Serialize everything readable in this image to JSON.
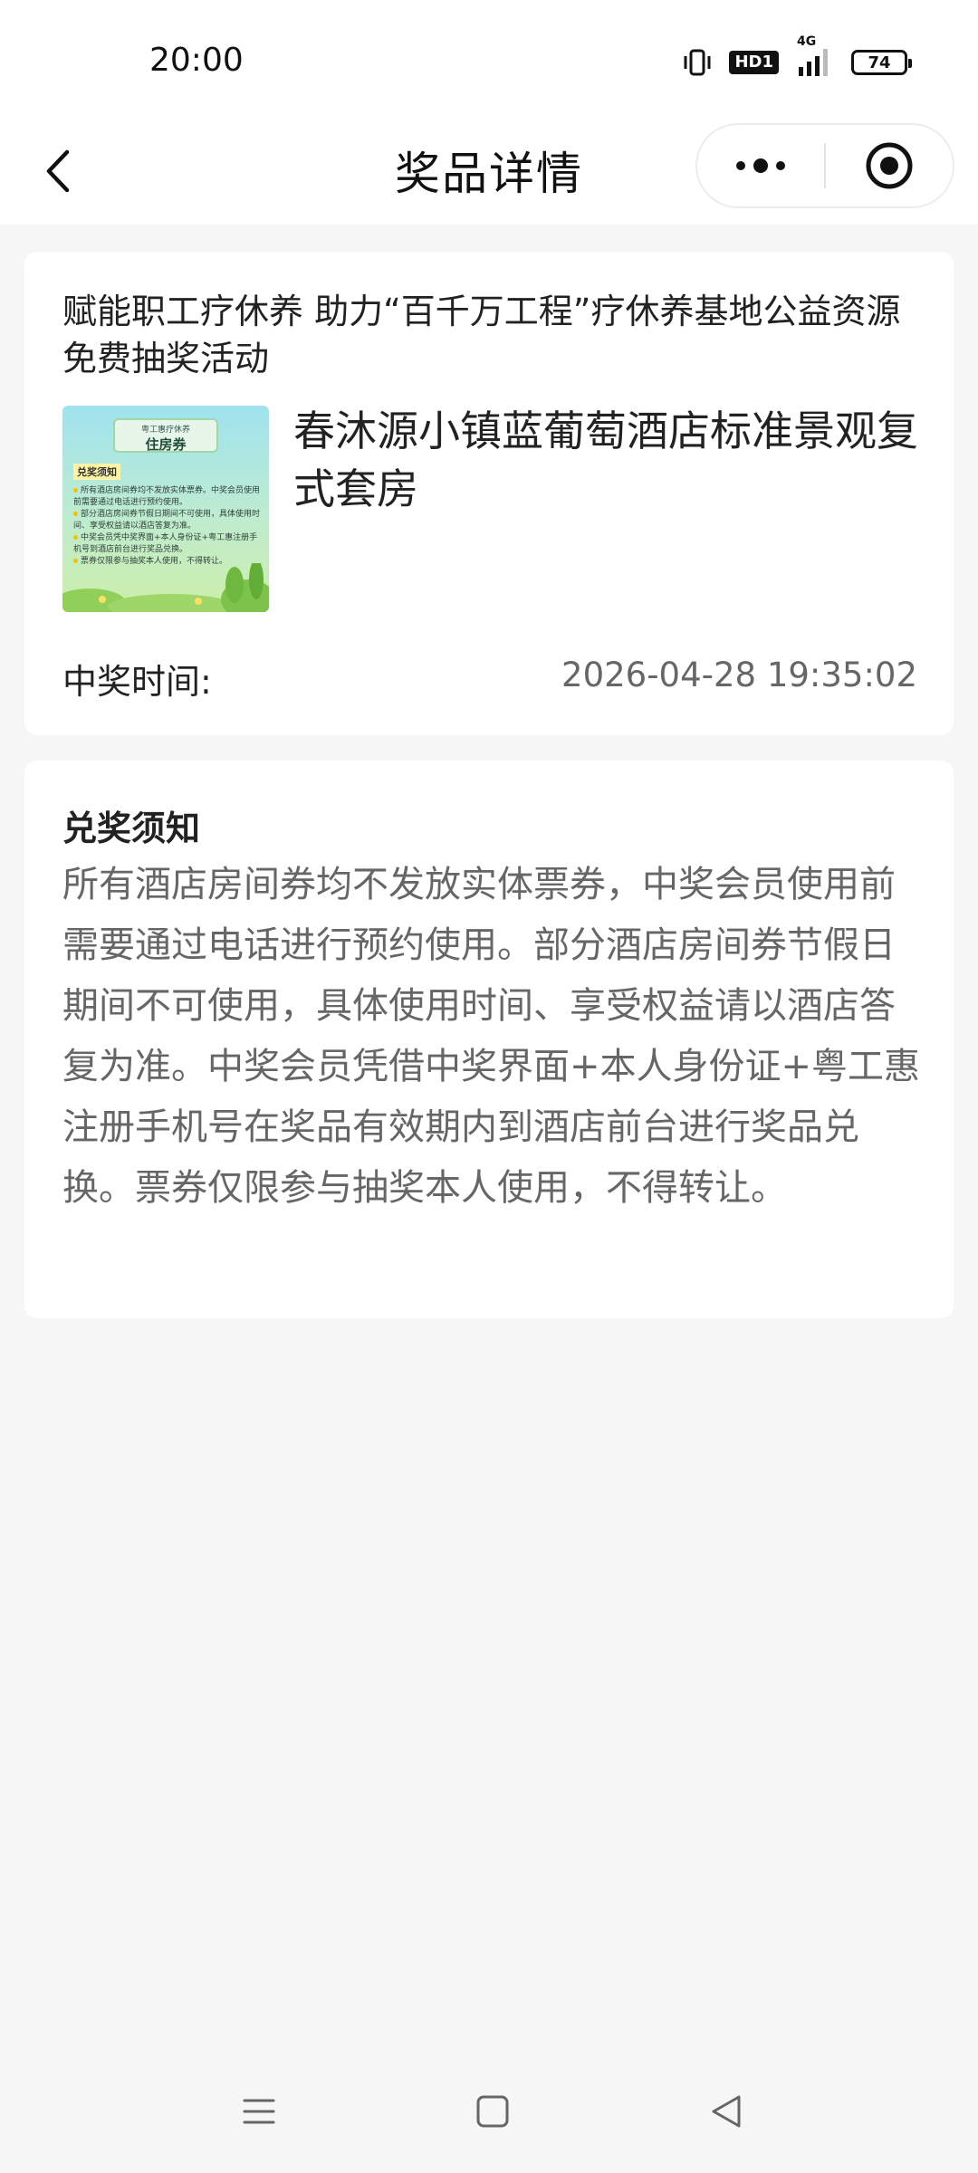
{
  "status_bar": {
    "time": "20:00",
    "icons": [
      "vibrate-icon",
      "hd-icon",
      "signal-4g-icon",
      "battery-icon"
    ],
    "hd_label": "HD1",
    "network_label": "4G",
    "battery_level": "74"
  },
  "nav": {
    "title": "奖品详情",
    "back_icon": "chevron-left-icon",
    "more_icon": "more-dots-icon",
    "target_icon": "target-icon"
  },
  "prize": {
    "activity_title": "赋能职工疗休养 助力“百千万工程”疗休养基地公益资源免费抽奖活动",
    "name": "春沐源小镇蓝葡萄酒店标准景观复式套房",
    "win_time_label": "中奖时间:",
    "win_time_value": "2026-04-28 19:35:02",
    "thumbnail": {
      "header_small": "粤工惠疗休养",
      "header_title": "住房券",
      "section_title": "兑奖须知",
      "lines": [
        "所有酒店房间券均不发放实体票券。中奖会员使用前需要通过电话进行预约使用。",
        "部分酒店房间券节假日期间不可使用，具体使用时间、享受权益请以酒店答复为准。",
        "中奖会员凭中奖界面+本人身份证+粤工惠注册手机号到酒店前台进行奖品兑换。",
        "票券仅限参与抽奖本人使用，不得转让。"
      ]
    }
  },
  "notice": {
    "title": "兑奖须知",
    "body": "所有酒店房间券均不发放实体票券，中奖会员使用前需要通过电话进行预约使用。部分酒店房间券节假日期间不可使用，具体使用时间、享受权益请以酒店答复为准。中奖会员凭借中奖界面+本人身份证+粤工惠注册手机号在奖品有效期内到酒店前台进行奖品兑换。票券仅限参与抽奖本人使用，不得转让。"
  },
  "system_nav": {
    "icons": [
      "menu-icon",
      "home-square-icon",
      "back-triangle-icon"
    ]
  },
  "colors": {
    "page_bg": "#f6f6f6",
    "card_bg": "#ffffff",
    "text_primary": "#222222",
    "text_secondary": "#666666"
  }
}
